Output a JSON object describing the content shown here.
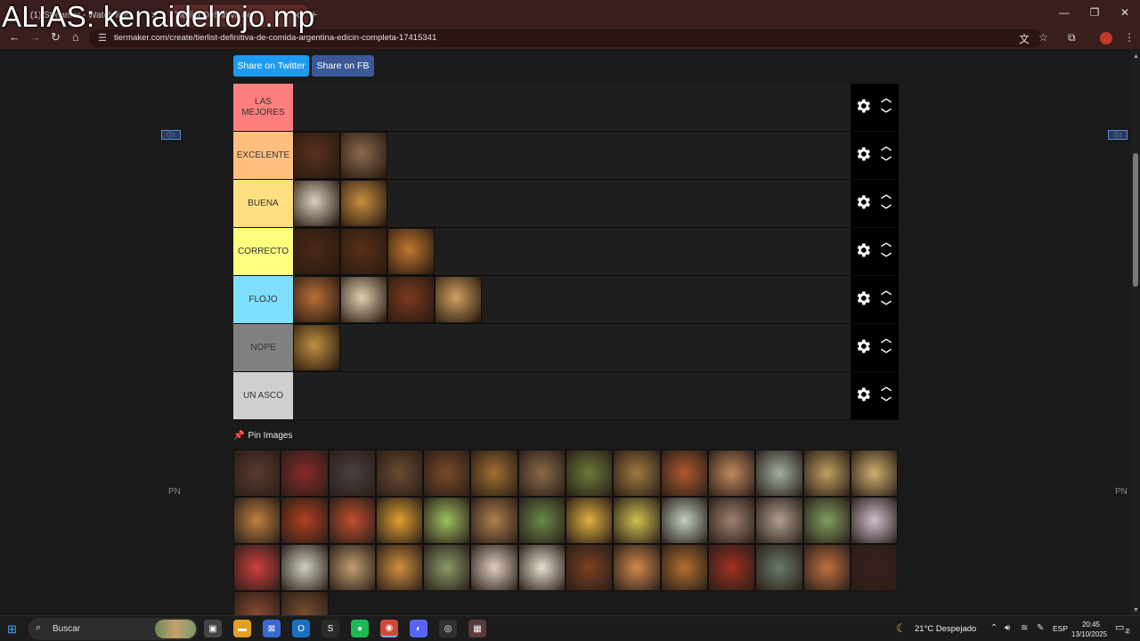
{
  "overlay_text": "ALIAS: kenaidelrojo.mp",
  "browser": {
    "tabs": [
      {
        "title": "(1) Streamer - Watch live",
        "active": false
      },
      {
        "title": "Tierlist Definitiva de",
        "active": false
      }
    ],
    "url": "tiermaker.com/create/tierlist-definitiva-de-comida-argentina-edicin-completa-17415341",
    "icons": [
      "back-icon",
      "forward-icon",
      "reload-icon",
      "home-icon",
      "site-info-icon",
      "translate-icon",
      "star-icon",
      "extensions-icon",
      "profile-icon",
      "menu-icon"
    ]
  },
  "share": {
    "twitter": "Share on Twitter",
    "facebook": "Share on FB"
  },
  "ad_marks": {
    "pn_left": "PN",
    "pn_right": "PN"
  },
  "tiers": [
    {
      "label": "LAS MEJORES",
      "color": "#ff7f7f",
      "items": []
    },
    {
      "label": "EXCELENTE",
      "color": "#ffbf7f",
      "items": [
        {
          "name": "brownie",
          "color": "#5a3020"
        },
        {
          "name": "stew",
          "color": "#8a6a50"
        }
      ]
    },
    {
      "label": "BUENA",
      "color": "#ffdf7f",
      "items": [
        {
          "name": "alfajores",
          "color": "#d8d0c0"
        },
        {
          "name": "flan",
          "color": "#c89040"
        }
      ]
    },
    {
      "label": "CORRECTO",
      "color": "#ffff7f",
      "items": [
        {
          "name": "chocolate-alfajor",
          "color": "#4a2818"
        },
        {
          "name": "chocolate-cone",
          "color": "#5a3018"
        },
        {
          "name": "medialunas",
          "color": "#c07830"
        }
      ]
    },
    {
      "label": "FLOJO",
      "color": "#7fdfff",
      "items": [
        {
          "name": "churros",
          "color": "#b87038"
        },
        {
          "name": "merengue-cake",
          "color": "#e0d0b0"
        },
        {
          "name": "croquettes",
          "color": "#7a3a20"
        },
        {
          "name": "crepes",
          "color": "#d0a060"
        }
      ]
    },
    {
      "label": "NOPE",
      "color": "#808080",
      "items": [
        {
          "name": "pastries",
          "color": "#c09040"
        }
      ]
    },
    {
      "label": "UN ASCO",
      "color": "#cfcfcf",
      "items": []
    }
  ],
  "pin_images": {
    "title": "Pin Images",
    "tiles": [
      "#5a3a30",
      "#8a2a2a",
      "#4a4040",
      "#6a4a30",
      "#7a4a2a",
      "#a07030",
      "#8a6a4a",
      "#6a7a3a",
      "#a07a40",
      "#b05a30",
      "#c08a60",
      "#a0b0a0",
      "#c0a060",
      "#d0b070",
      "#c08040",
      "#b04020",
      "#c05030",
      "#e0a030",
      "#a0c060",
      "#b08050",
      "#6a8a4a",
      "#e0b040",
      "#d0c050",
      "#c0d0c0",
      "#a08070",
      "#b0a090",
      "#80a060",
      "#d0c0d0",
      "#d04040",
      "#d0d0c0",
      "#c0a070",
      "#d09040",
      "#8a9a6a",
      "#e0d0c0",
      "#e8e0d0",
      "#7a4020",
      "#d08a50",
      "#b07030",
      "#a03020",
      "#6a7a6a",
      "#c07040",
      "#3a2020",
      "#8a4a30",
      "#7a5030"
    ]
  },
  "taskbar": {
    "search_placeholder": "Buscar",
    "weather": "21°C  Despejado",
    "language": "ESP",
    "time": "20:45",
    "date": "13/10/2025",
    "notifications": "2",
    "apps": [
      "task-view-icon",
      "file-explorer-icon",
      "store-icon",
      "outlook-icon",
      "steam-icon",
      "spotify-icon",
      "chrome-icon",
      "discord-icon",
      "obs-icon",
      "app-icon"
    ]
  }
}
